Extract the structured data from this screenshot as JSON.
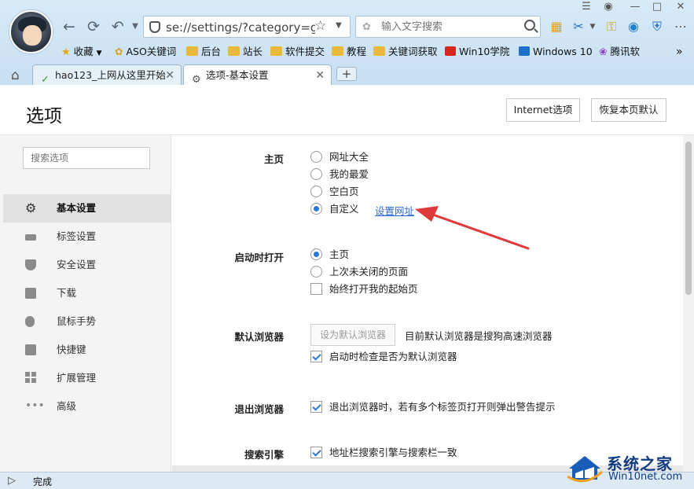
{
  "browser": {
    "address_url": "se://settings/?category=gen",
    "search_placeholder": "输入文字搜索",
    "bookmarks": [
      {
        "label": "收藏",
        "icon": "star-icon"
      },
      {
        "label": "ASO关键词",
        "icon": "aso-icon"
      },
      {
        "label": "后台",
        "icon": "folder-icon"
      },
      {
        "label": "站长",
        "icon": "folder-icon"
      },
      {
        "label": "软件提交",
        "icon": "folder-icon"
      },
      {
        "label": "教程",
        "icon": "folder-icon"
      },
      {
        "label": "关键词获取",
        "icon": "folder-icon"
      },
      {
        "label": "Win10学院",
        "icon": "it-icon"
      },
      {
        "label": "Windows 10",
        "icon": "zhi-icon"
      },
      {
        "label": "腾讯软",
        "icon": "tencent-icon"
      }
    ],
    "tabs": [
      {
        "label": "hao123_上网从这里开始",
        "active": false
      },
      {
        "label": "选项-基本设置",
        "active": true
      }
    ],
    "status_text": "完成"
  },
  "page": {
    "title": "选项",
    "internet_options_label": "Internet选项",
    "restore_defaults_label": "恢复本页默认"
  },
  "sidebar": {
    "search_placeholder": "搜索选项",
    "items": [
      {
        "label": "基本设置",
        "icon": "gear-icon",
        "active": true
      },
      {
        "label": "标签设置",
        "icon": "tab-icon",
        "active": false
      },
      {
        "label": "安全设置",
        "icon": "shield-check-icon",
        "active": false
      },
      {
        "label": "下载",
        "icon": "download-icon",
        "active": false
      },
      {
        "label": "鼠标手势",
        "icon": "mouse-icon",
        "active": false
      },
      {
        "label": "快捷键",
        "icon": "shortcut-arrow-icon",
        "active": false
      },
      {
        "label": "扩展管理",
        "icon": "extensions-grid-icon",
        "active": false
      },
      {
        "label": "高级",
        "icon": "more-dots-icon",
        "active": false
      }
    ]
  },
  "settings": {
    "homepage": {
      "label": "主页",
      "options": [
        "网址大全",
        "我的最爱",
        "空白页",
        "自定义"
      ],
      "selected": "自定义",
      "set_url_link": "设置网址"
    },
    "startup": {
      "label": "启动时打开",
      "options": [
        "主页",
        "上次未关闭的页面"
      ],
      "selected": "主页",
      "always_open_start": "始终打开我的起始页",
      "always_open_start_checked": false
    },
    "default_browser": {
      "label": "默认浏览器",
      "set_default_button": "设为默认浏览器",
      "status": "目前默认浏览器是搜狗高速浏览器",
      "check_on_start": "启动时检查是否为默认浏览器",
      "check_on_start_checked": true
    },
    "exit": {
      "label": "退出浏览器",
      "warn_multiple_tabs": "退出浏览器时，若有多个标签页打开则弹出警告提示",
      "warn_checked": true
    },
    "search_engine": {
      "label": "搜索引擎",
      "sync_address_bar": "地址栏搜索引擎与搜索栏一致",
      "sync_checked": true
    }
  },
  "watermark": {
    "line1": "系统之家",
    "line2": "Win10net.com"
  },
  "colors": {
    "accent": "#2d78d6",
    "link": "#2b6bd0",
    "annotation_arrow": "#e0393b"
  }
}
